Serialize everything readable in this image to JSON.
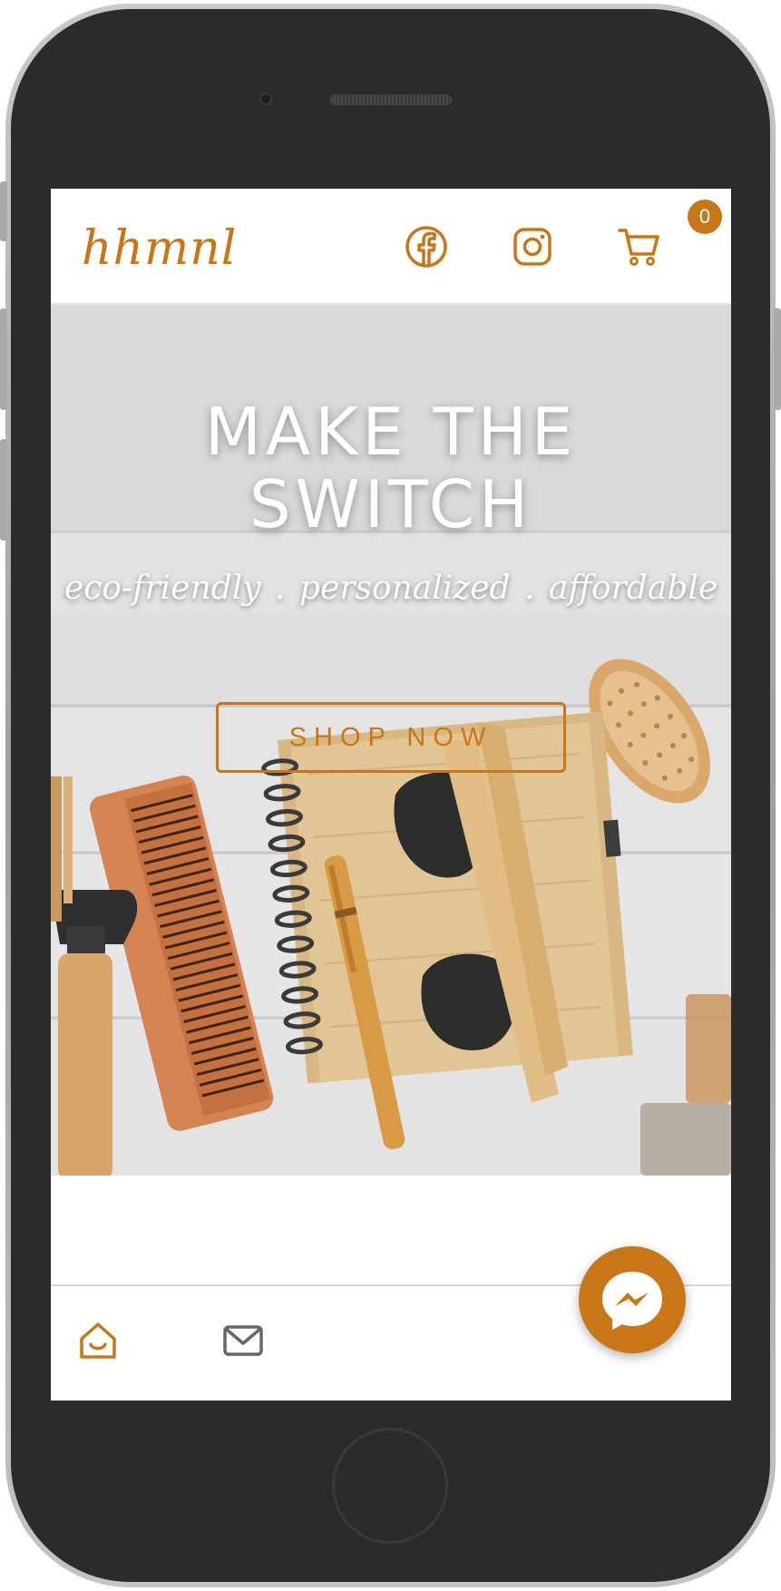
{
  "header": {
    "logo": "hhmnl",
    "icons": [
      "facebook-icon",
      "instagram-icon",
      "cart-icon"
    ],
    "cart_count": "0"
  },
  "hero": {
    "title_line1": "MAKE THE",
    "title_line2": "SWITCH",
    "tagline": "eco-friendly . personalized . affordable",
    "cta_label": "SHOP NOW"
  },
  "bottom_nav": {
    "items": [
      "home-icon",
      "mail-icon"
    ]
  },
  "chat": {
    "icon": "messenger-icon"
  },
  "colors": {
    "accent": "#c87617",
    "phone_body": "#2b2b2b",
    "nav_icon_gray": "#666666"
  }
}
